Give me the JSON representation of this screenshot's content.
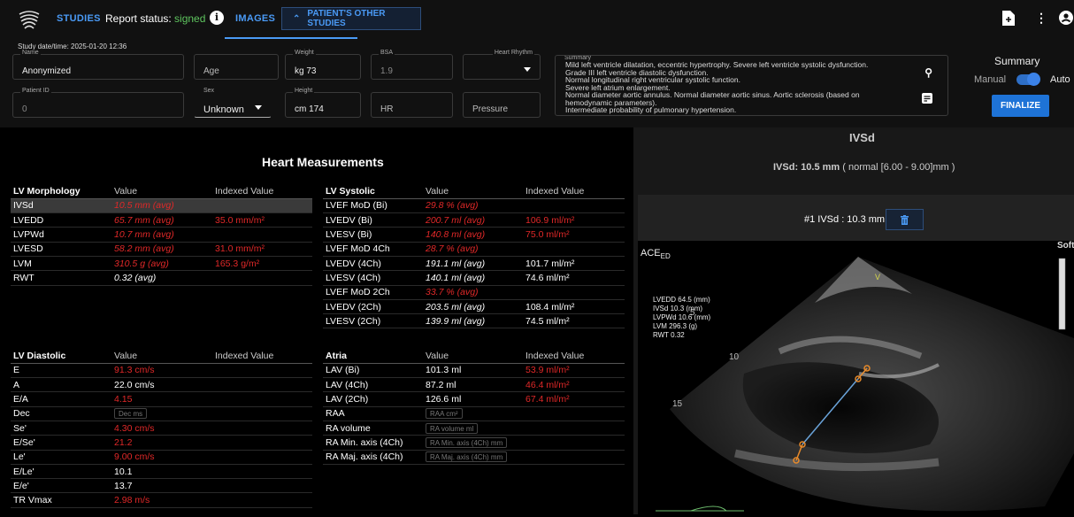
{
  "header": {
    "studies": "STUDIES",
    "report_label": "Report status:",
    "report_status": "signed",
    "images": "IMAGES",
    "other_studies": "PATIENT'S OTHER STUDIES"
  },
  "study": {
    "datetime": "Study date/time: 2025-01-20 12:36",
    "name_label": "Name",
    "name": "Anonymized",
    "age_ph": "Age",
    "weight_label": "Weight",
    "weight": "kg  73",
    "bsa_label": "BSA",
    "bsa": "1.9",
    "rhythm_label": "Heart Rhythm",
    "patient_id_label": "Patient ID",
    "patient_id": "0",
    "sex_label": "Sex",
    "sex": "Unknown",
    "height_label": "Height",
    "height": "cm  174",
    "hr_ph": "HR",
    "pressure_ph": "Pressure",
    "summary_label": "Summary",
    "summary_lines": [
      "Mild left ventricle dilatation, eccentric hypertrophy. Severe left ventricle systolic dysfunction.",
      "Grade III left ventricle diastolic dysfunction.",
      "Normal longitudinal right ventricular systolic function.",
      "Severe left atrium enlargement.",
      "Normal diameter aortic annulus. Normal diameter aortic sinus. Aortic sclerosis (based on hemodynamic parameters).",
      "Intermediate probability of pulmonary hypertension."
    ]
  },
  "summary_ctl": {
    "title": "Summary",
    "manual": "Manual",
    "auto": "Auto",
    "finalize": "FINALIZE"
  },
  "hm_title": "Heart Measurements",
  "tables": {
    "lv_morph": {
      "head": [
        "LV Morphology",
        "Value",
        "Indexed Value"
      ],
      "rows": [
        [
          "IVSd",
          "10.5 mm (avg)",
          ""
        ],
        [
          "LVEDD",
          "65.7 mm (avg)",
          "35.0 mm/m²"
        ],
        [
          "LVPWd",
          "10.7 mm (avg)",
          ""
        ],
        [
          "LVESD",
          "58.2 mm (avg)",
          "31.0 mm/m²"
        ],
        [
          "LVM",
          "310.5 g (avg)",
          "165.3 g/m²"
        ],
        [
          "RWT",
          "0.32 (avg)",
          ""
        ]
      ]
    },
    "lv_sys": {
      "head": [
        "LV Systolic",
        "Value",
        "Indexed Value"
      ],
      "rows": [
        [
          "LVEF MoD (Bi)",
          "29.8 % (avg)",
          ""
        ],
        [
          "LVEDV (Bi)",
          "200.7 ml (avg)",
          "106.9 ml/m²"
        ],
        [
          "LVESV (Bi)",
          "140.8 ml (avg)",
          "75.0 ml/m²"
        ],
        [
          "LVEF MoD 4Ch",
          "28.7 % (avg)",
          ""
        ],
        [
          "LVEDV (4Ch)",
          "191.1 ml (avg)",
          "101.7 ml/m²"
        ],
        [
          "LVESV (4Ch)",
          "140.1 ml (avg)",
          "74.6 ml/m²"
        ],
        [
          "LVEF MoD 2Ch",
          "33.7 % (avg)",
          ""
        ],
        [
          "LVEDV (2Ch)",
          "203.5 ml (avg)",
          "108.4 ml/m²"
        ],
        [
          "LVESV (2Ch)",
          "139.9 ml (avg)",
          "74.5 ml/m²"
        ]
      ]
    },
    "lv_dia": {
      "head": [
        "LV Diastolic",
        "Value",
        "Indexed Value"
      ],
      "rows": [
        [
          "E",
          "91.3 cm/s",
          ""
        ],
        [
          "A",
          "22.0 cm/s",
          ""
        ],
        [
          "E/A",
          "4.15",
          ""
        ],
        [
          "Dec",
          "Dec ms",
          ""
        ],
        [
          "Se'",
          "4.30 cm/s",
          ""
        ],
        [
          "E/Se'",
          "21.2",
          ""
        ],
        [
          "Le'",
          "9.00 cm/s",
          ""
        ],
        [
          "E/Le'",
          "10.1",
          ""
        ],
        [
          "E/e'",
          "13.7",
          ""
        ],
        [
          "TR Vmax",
          "2.98 m/s",
          ""
        ]
      ]
    },
    "atria": {
      "head": [
        "Atria",
        "Value",
        "Indexed Value"
      ],
      "rows": [
        [
          "LAV (Bi)",
          "101.3 ml",
          "53.9 ml/m²"
        ],
        [
          "LAV (4Ch)",
          "87.2 ml",
          "46.4 ml/m²"
        ],
        [
          "LAV (2Ch)",
          "126.6 ml",
          "67.4 ml/m²"
        ],
        [
          "RAA",
          "RAA cm²",
          ""
        ],
        [
          "RA volume",
          "RA volume ml",
          ""
        ],
        [
          "RA Min. axis (4Ch)",
          "RA Min. axis (4Ch) mm",
          ""
        ],
        [
          "RA Maj. axis (4Ch)",
          "RA Maj. axis (4Ch) mm",
          ""
        ]
      ]
    }
  },
  "ivsd": {
    "title": "IVSd",
    "label": "IVSd:",
    "value": "10.5 mm",
    "normal": "( normal [6.00 - 9.00]mm )",
    "measurement": "#1 IVSd : 10.3 mm"
  },
  "image": {
    "ace": "ACE",
    "ace_sub": "ED",
    "soft": "Soft",
    "overlay": [
      "LVEDD 64.5 (mm)",
      "IVSd 10.3 (mm)",
      "LVPWd 10.6 (mm)",
      "LVM 296.3 (g)",
      "RWT 0.32"
    ],
    "depth_marks": [
      "5",
      "10",
      "15"
    ],
    "v_mark": "V"
  }
}
